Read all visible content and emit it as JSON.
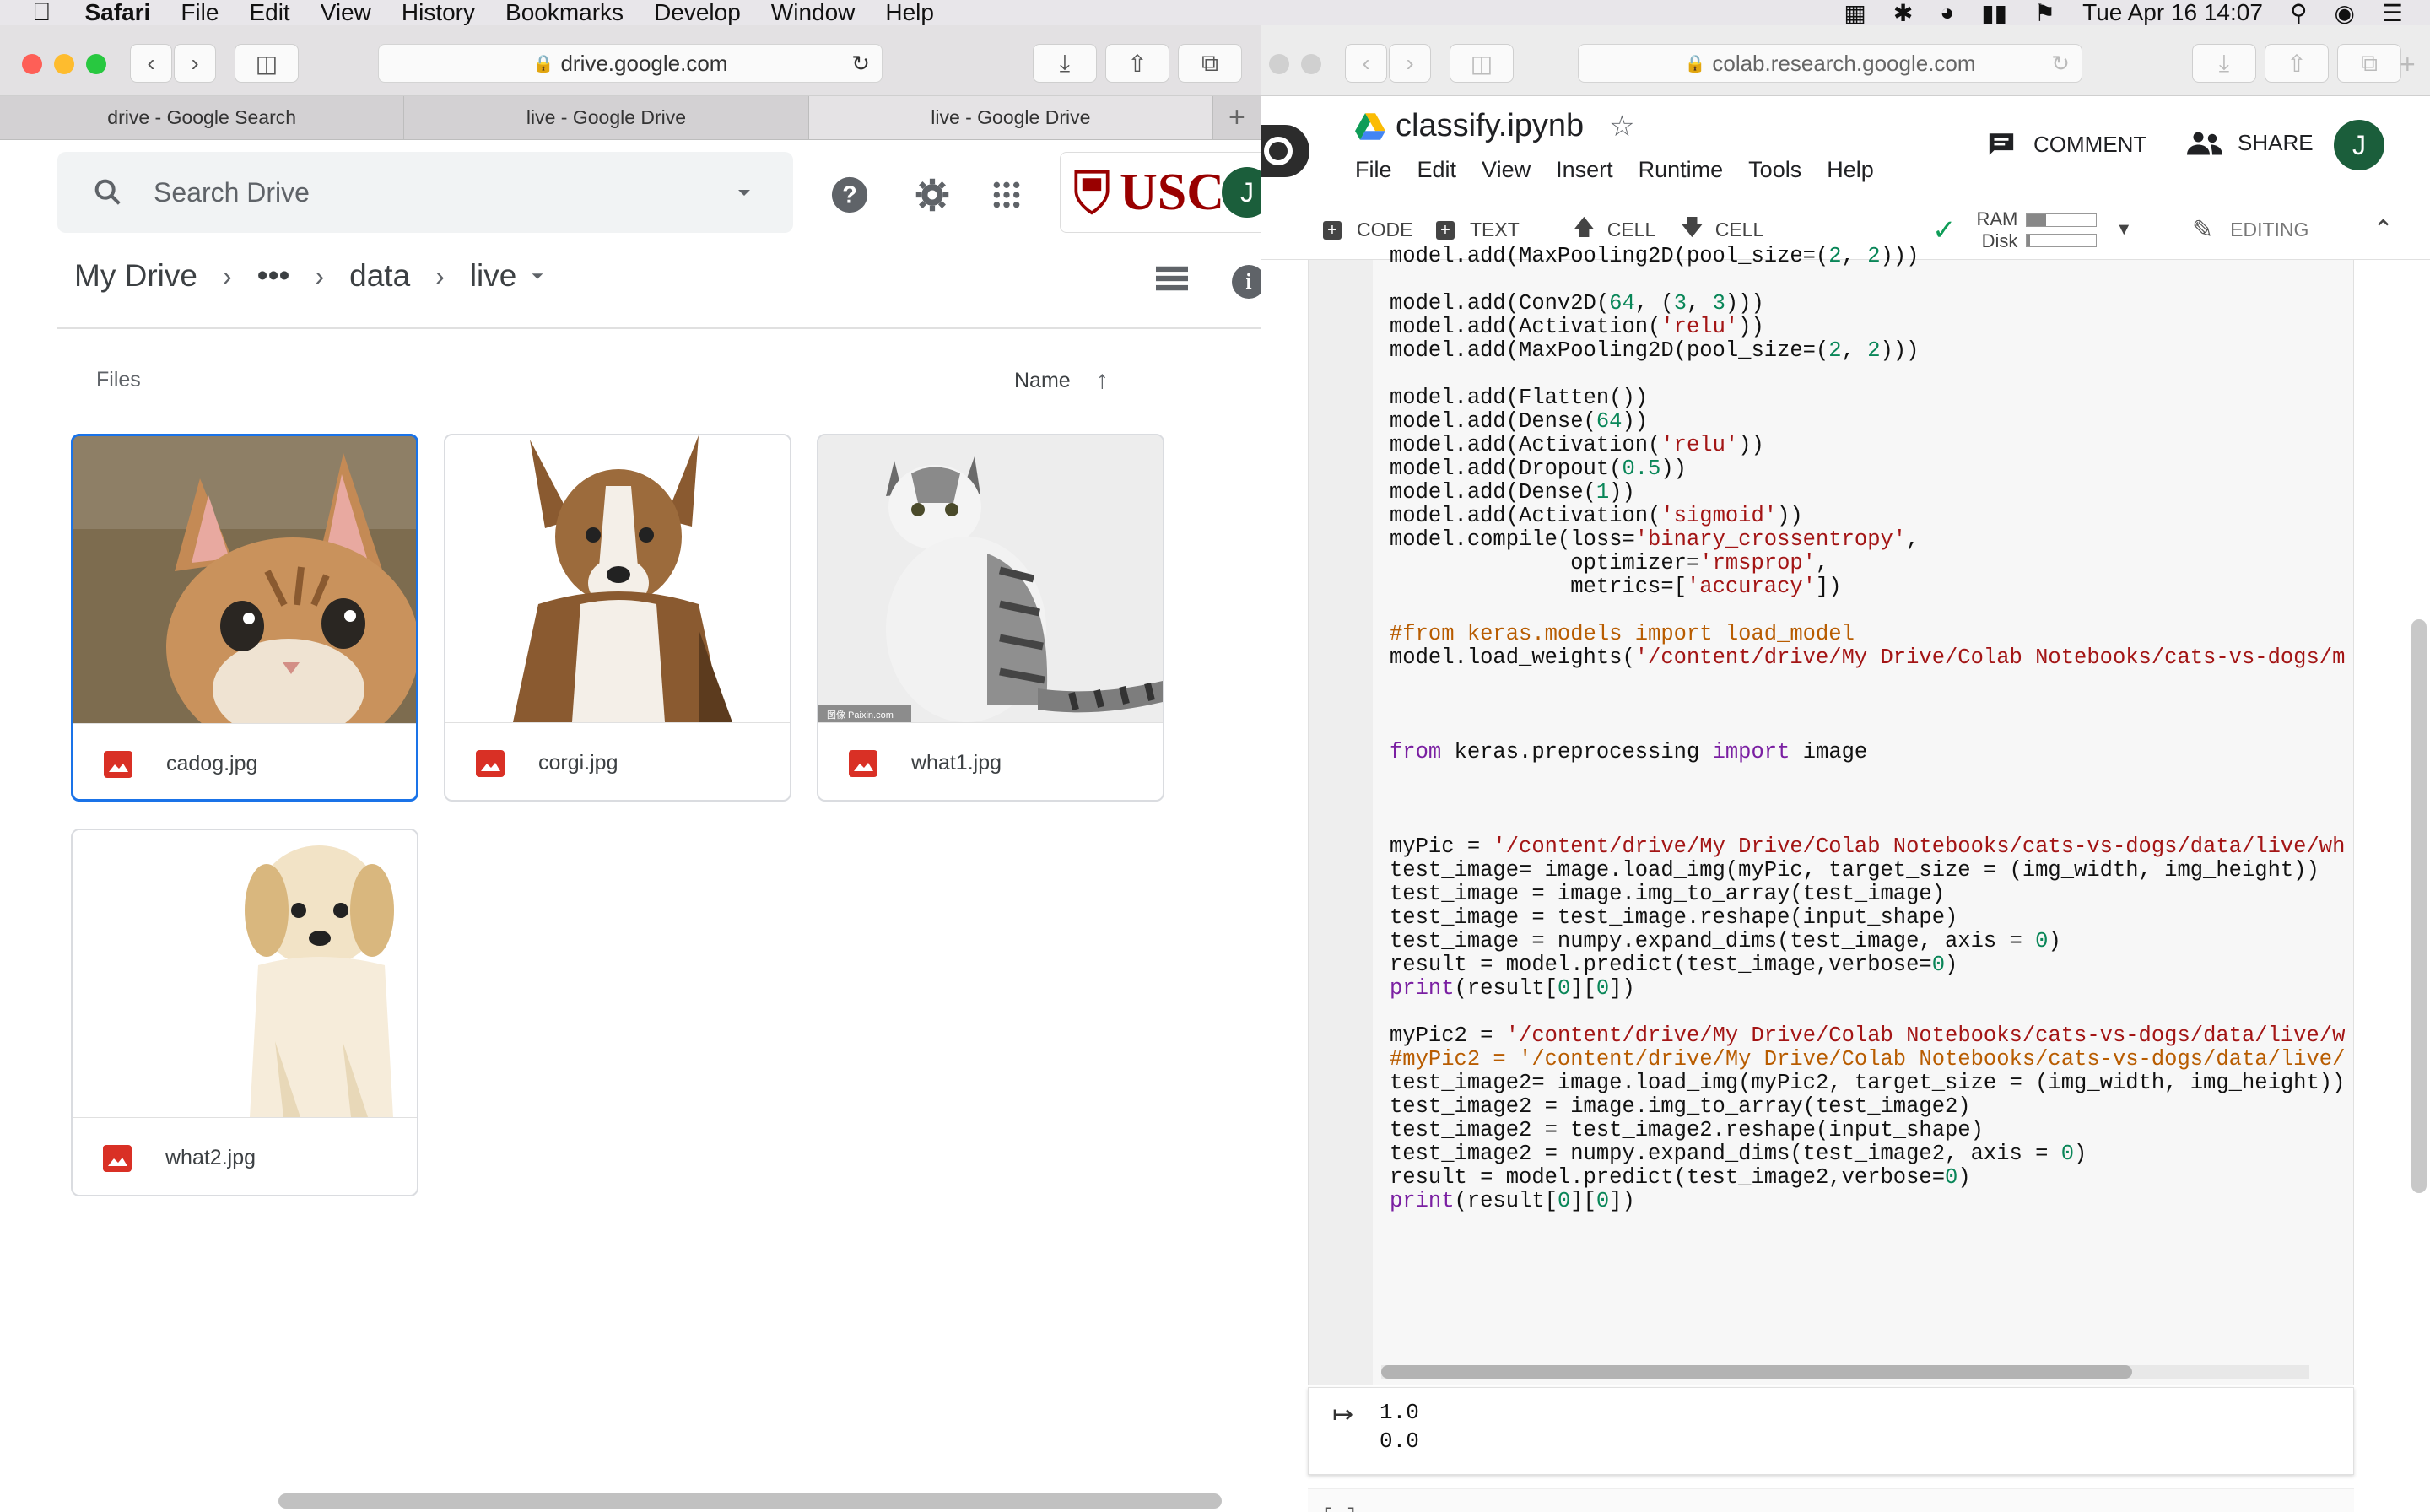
{
  "menubar": {
    "app": "Safari",
    "items": [
      "File",
      "Edit",
      "View",
      "History",
      "Bookmarks",
      "Develop",
      "Window",
      "Help"
    ],
    "clock": "Tue Apr 16  14:07"
  },
  "left_window": {
    "url": "drive.google.com",
    "tabs": [
      "drive - Google Search",
      "live - Google Drive",
      "live - Google Drive"
    ],
    "plus": "+"
  },
  "drive": {
    "search_placeholder": "Search Drive",
    "brand": "USC",
    "avatar": "J",
    "breadcrumb": [
      "My Drive",
      "•••",
      "data",
      "live"
    ],
    "files_label": "Files",
    "sort_label": "Name",
    "files": [
      {
        "name": "cadog.jpg",
        "selected": true
      },
      {
        "name": "corgi.jpg",
        "selected": false
      },
      {
        "name": "what1.jpg",
        "selected": false
      },
      {
        "name": "what2.jpg",
        "selected": false
      }
    ],
    "watermark": "图像 Paixin.com"
  },
  "right_window": {
    "url": "colab.research.google.com"
  },
  "colab": {
    "title": "classify.ipynb",
    "menus": [
      "File",
      "Edit",
      "View",
      "Insert",
      "Runtime",
      "Tools",
      "Help"
    ],
    "comment": "COMMENT",
    "share": "SHARE",
    "avatar": "J",
    "toolbar": {
      "code": "CODE",
      "text": "TEXT",
      "cell_up": "CELL",
      "cell_down": "CELL",
      "ram": "RAM",
      "disk": "Disk",
      "editing": "EDITING"
    },
    "output": [
      "1.0",
      "0.0"
    ],
    "empty_cell": "[ ]"
  }
}
